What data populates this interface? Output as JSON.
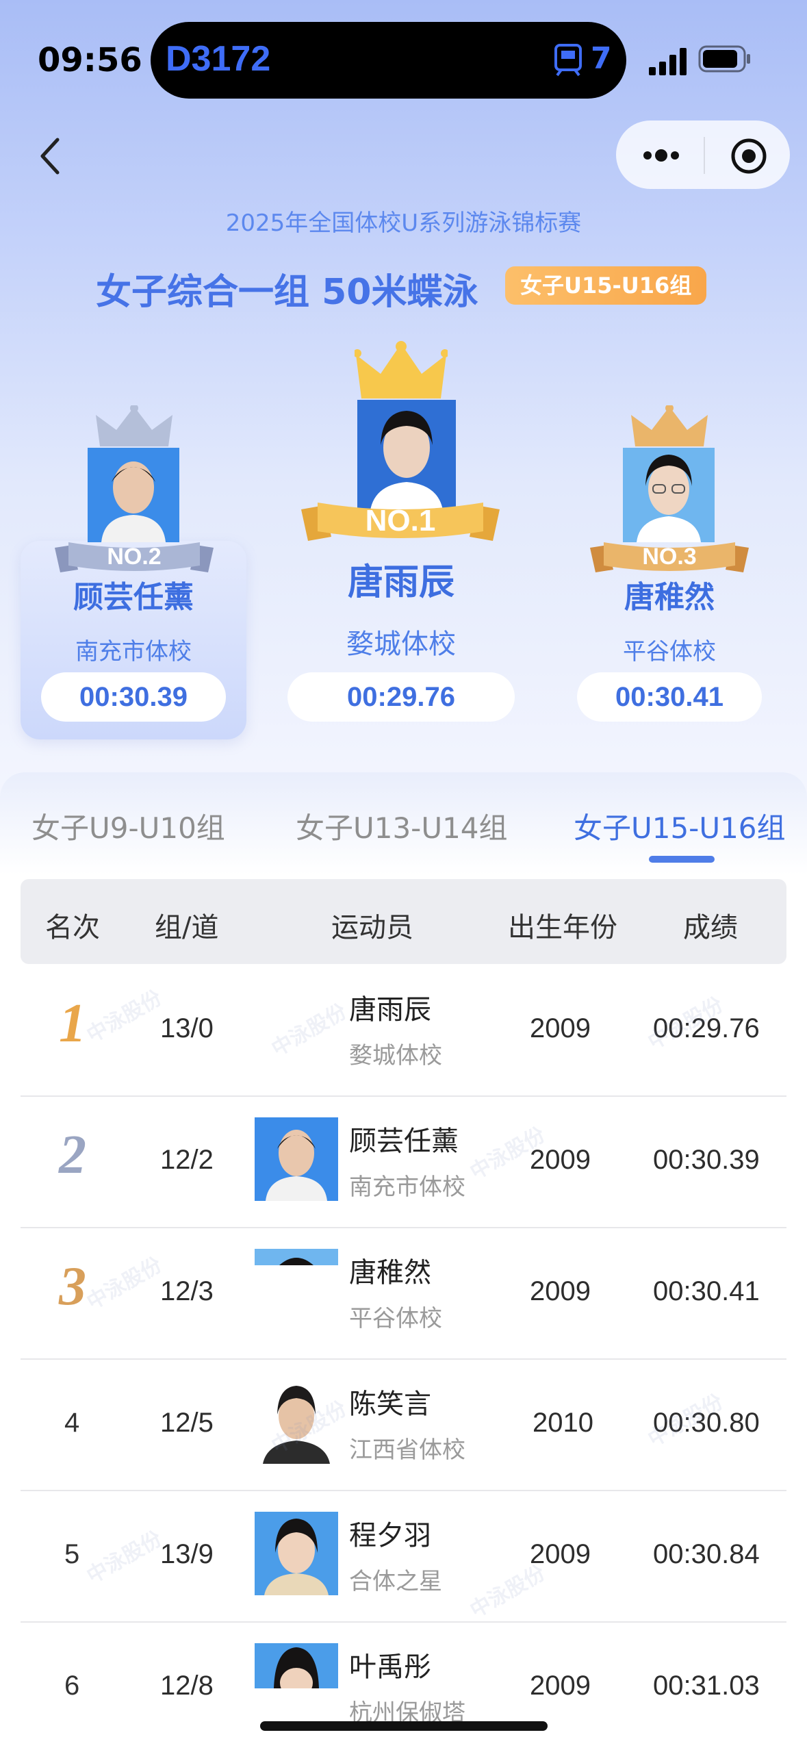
{
  "status_bar": {
    "time": "09:56",
    "live_activity_code": "D3172",
    "live_activity_count": "7"
  },
  "header": {
    "competition": "2025年全国体校U系列游泳锦标赛",
    "event_title": "女子综合一组 50米蝶泳",
    "group_badge": "女子U15-U16组"
  },
  "podium": [
    {
      "rank_label": "NO.1",
      "name": "唐雨辰",
      "school": "婺城体校",
      "time": "00:29.76"
    },
    {
      "rank_label": "NO.2",
      "name": "顾芸任薰",
      "school": "南充市体校",
      "time": "00:30.39"
    },
    {
      "rank_label": "NO.3",
      "name": "唐稚然",
      "school": "平谷体校",
      "time": "00:30.41"
    }
  ],
  "tabs": [
    {
      "label": "女子U9-U10组",
      "active": false
    },
    {
      "label": "女子U13-U14组",
      "active": false
    },
    {
      "label": "女子U15-U16组",
      "active": true
    }
  ],
  "table": {
    "columns": [
      "名次",
      "组/道",
      "运动员",
      "出生年份",
      "成绩"
    ],
    "rows": [
      {
        "rank": "1",
        "heat_lane": "13/0",
        "name": "唐雨辰",
        "school": "婺城体校",
        "birth_year": "2009",
        "result": "00:29.76"
      },
      {
        "rank": "2",
        "heat_lane": "12/2",
        "name": "顾芸任薰",
        "school": "南充市体校",
        "birth_year": "2009",
        "result": "00:30.39"
      },
      {
        "rank": "3",
        "heat_lane": "12/3",
        "name": "唐稚然",
        "school": "平谷体校",
        "birth_year": "2009",
        "result": "00:30.41"
      },
      {
        "rank": "4",
        "heat_lane": "12/5",
        "name": "陈笑言",
        "school": "江西省体校",
        "birth_year": "2010",
        "result": "00:30.80"
      },
      {
        "rank": "5",
        "heat_lane": "13/9",
        "name": "程夕羽",
        "school": "合体之星",
        "birth_year": "2009",
        "result": "00:30.84"
      },
      {
        "rank": "6",
        "heat_lane": "12/8",
        "name": "叶禹彤",
        "school": "杭州保俶塔",
        "birth_year": "2009",
        "result": "00:31.03"
      }
    ]
  },
  "watermark": "中泳股份",
  "colors": {
    "accent_blue": "#3f6fe0",
    "gold": "#f7c84c",
    "silver": "#a7b3d0",
    "bronze": "#e0a85e",
    "badge_orange": "#f9a64a"
  }
}
